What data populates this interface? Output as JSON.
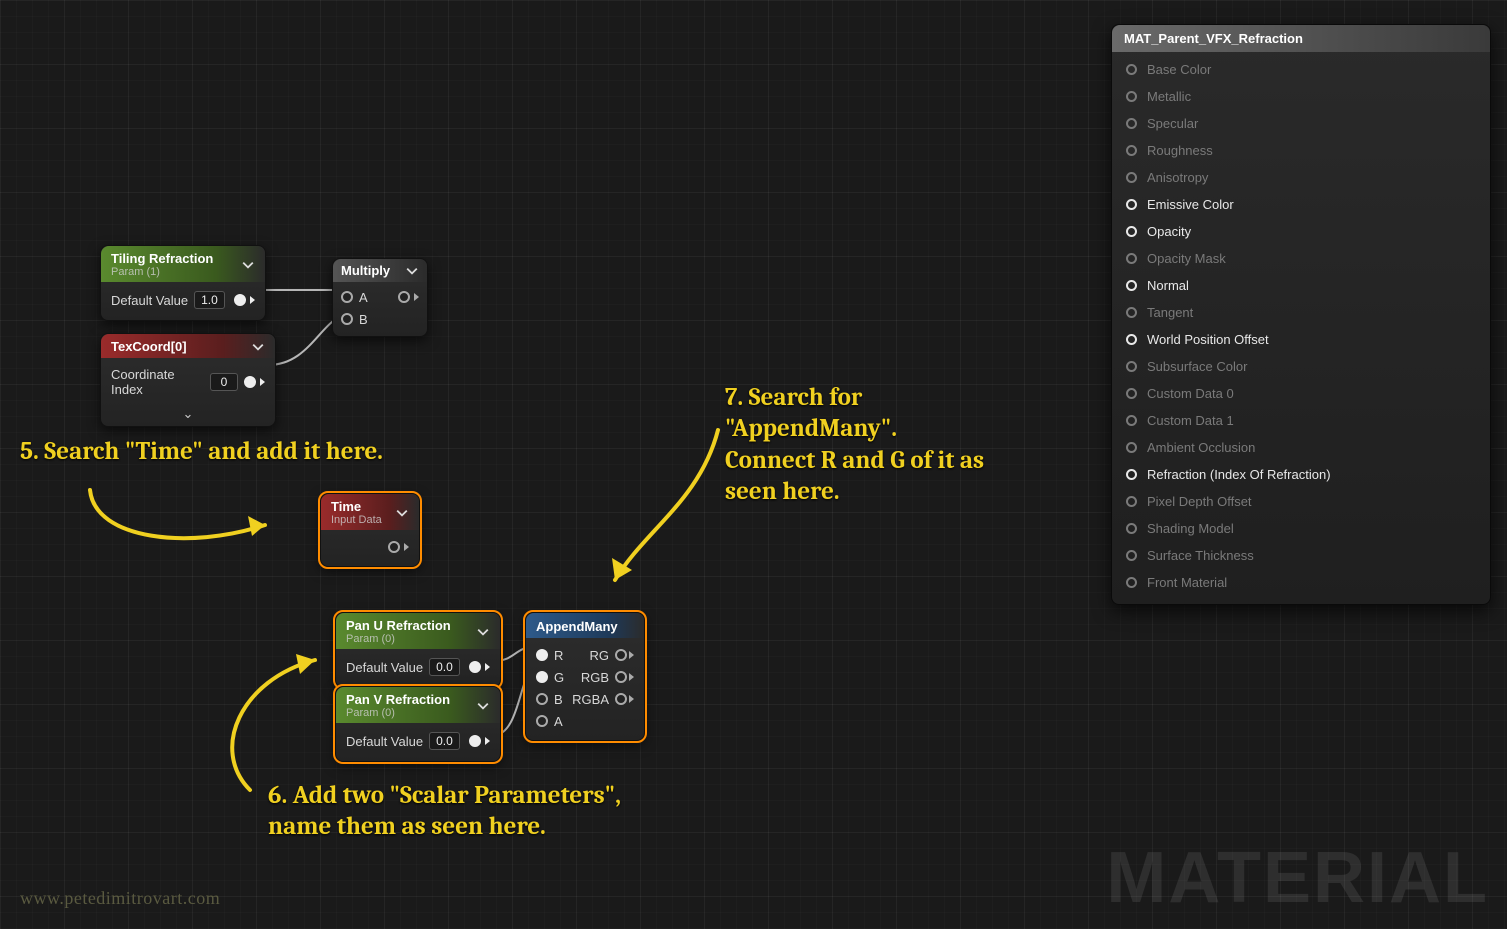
{
  "nodes": {
    "tiling": {
      "title": "Tiling Refraction",
      "subtitle": "Param (1)",
      "default_label": "Default Value",
      "default_value": "1.0"
    },
    "texcoord": {
      "title": "TexCoord[0]",
      "coord_label": "Coordinate Index",
      "coord_value": "0"
    },
    "multiply": {
      "title": "Multiply",
      "pin_a": "A",
      "pin_b": "B"
    },
    "time": {
      "title": "Time",
      "subtitle": "Input Data"
    },
    "pan_u": {
      "title": "Pan U Refraction",
      "subtitle": "Param (0)",
      "default_label": "Default Value",
      "default_value": "0.0"
    },
    "pan_v": {
      "title": "Pan V Refraction",
      "subtitle": "Param (0)",
      "default_label": "Default Value",
      "default_value": "0.0"
    },
    "append": {
      "title": "AppendMany",
      "in": [
        "R",
        "G",
        "B",
        "A"
      ],
      "out": [
        "RG",
        "RGB",
        "RGBA"
      ]
    }
  },
  "annotations": {
    "a5": "5. Search \"Time\" and add it here.",
    "a6": "6. Add two \"Scalar Parameters\",\nname them as seen here.",
    "a7": "7. Search for\n\"AppendMany\".\nConnect R and G of it as\nseen here."
  },
  "material_output": {
    "title": "MAT_Parent_VFX_Refraction",
    "pins": [
      {
        "label": "Base Color",
        "active": false
      },
      {
        "label": "Metallic",
        "active": false
      },
      {
        "label": "Specular",
        "active": false
      },
      {
        "label": "Roughness",
        "active": false
      },
      {
        "label": "Anisotropy",
        "active": false
      },
      {
        "label": "Emissive Color",
        "active": true
      },
      {
        "label": "Opacity",
        "active": true
      },
      {
        "label": "Opacity Mask",
        "active": false
      },
      {
        "label": "Normal",
        "active": true
      },
      {
        "label": "Tangent",
        "active": false
      },
      {
        "label": "World Position Offset",
        "active": true
      },
      {
        "label": "Subsurface Color",
        "active": false
      },
      {
        "label": "Custom Data 0",
        "active": false
      },
      {
        "label": "Custom Data 1",
        "active": false
      },
      {
        "label": "Ambient Occlusion",
        "active": false
      },
      {
        "label": "Refraction (Index Of Refraction)",
        "active": true
      },
      {
        "label": "Pixel Depth Offset",
        "active": false
      },
      {
        "label": "Shading Model",
        "active": false
      },
      {
        "label": "Surface Thickness",
        "active": false
      },
      {
        "label": "Front Material",
        "active": false
      }
    ]
  },
  "watermark": {
    "url": "www.petedimitrovart.com",
    "label": "MATERIAL"
  }
}
